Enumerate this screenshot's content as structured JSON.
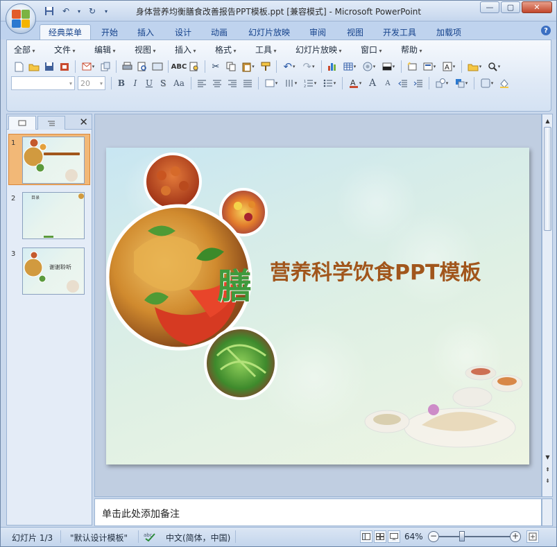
{
  "window": {
    "title": "身体营养均衡膳食改善报告PPT模板.ppt [兼容模式] - Microsoft PowerPoint",
    "controls": {
      "minimize": "—",
      "maximize": "▢",
      "close": "✕"
    }
  },
  "quick_access": {
    "save_icon": "save-icon",
    "undo_icon": "undo-icon",
    "redo_icon": "redo-icon",
    "customize": "▾"
  },
  "ribbon_tabs": [
    {
      "label": "经典菜单",
      "active": true
    },
    {
      "label": "开始"
    },
    {
      "label": "插入"
    },
    {
      "label": "设计"
    },
    {
      "label": "动画"
    },
    {
      "label": "幻灯片放映"
    },
    {
      "label": "审阅"
    },
    {
      "label": "视图"
    },
    {
      "label": "开发工具"
    },
    {
      "label": "加载项"
    }
  ],
  "help_label": "?",
  "menus": [
    "全部",
    "文件",
    "编辑",
    "视图",
    "插入",
    "格式",
    "工具",
    "幻灯片放映",
    "窗口",
    "帮助"
  ],
  "font_combo": {
    "font_value": "",
    "size_value": "20"
  },
  "format_buttons": {
    "bold": "B",
    "italic": "I",
    "underline": "U",
    "shadow": "S",
    "case": "Aa"
  },
  "left_pane": {
    "tabs": [
      "slides-tab",
      "outline-tab"
    ],
    "close_label": "✕",
    "slides": [
      {
        "number": "1",
        "caption": "营养科学饮食PPT模板"
      },
      {
        "number": "2",
        "caption": "目录"
      },
      {
        "number": "3",
        "caption": "谢谢聆听"
      }
    ]
  },
  "slide": {
    "title": "营养科学饮食PPT模板",
    "calligraphy": "膳"
  },
  "notes": {
    "placeholder": "单击此处添加备注"
  },
  "status": {
    "slide_counter": "幻灯片 1/3",
    "theme": "\"默认设计模板\"",
    "language": "中文(简体，中国)",
    "zoom": "64%",
    "zoom_level": 0.32
  },
  "colors": {
    "accent": "#a1561c",
    "calligraphy": "#3f9a3d",
    "selection": "#f2b877"
  }
}
